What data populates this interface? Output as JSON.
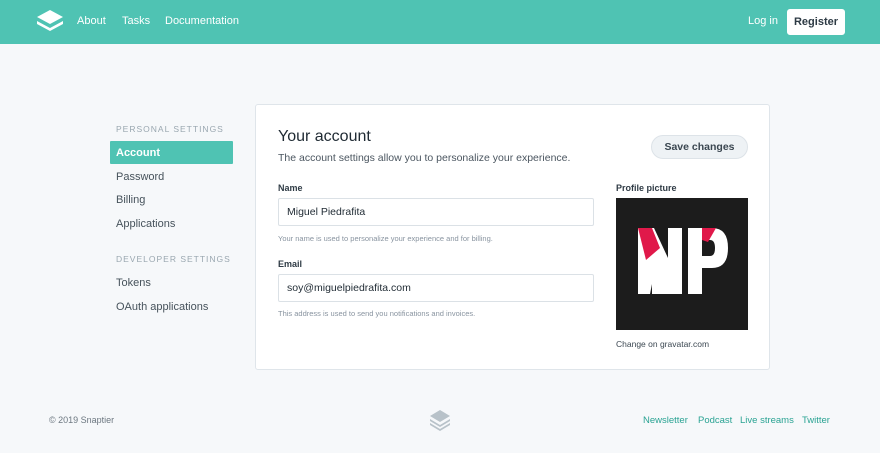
{
  "header": {
    "nav": [
      "About",
      "Tasks",
      "Documentation"
    ],
    "login": "Log in",
    "register": "Register"
  },
  "sidebar": {
    "personal_heading": "PERSONAL SETTINGS",
    "personal_items": [
      "Account",
      "Password",
      "Billing",
      "Applications"
    ],
    "developer_heading": "DEVELOPER SETTINGS",
    "developer_items": [
      "Tokens",
      "OAuth applications"
    ],
    "active_item": "Account"
  },
  "account": {
    "title": "Your account",
    "description": "The account settings allow you to personalize your experience.",
    "save_label": "Save changes",
    "name_label": "Name",
    "name_value": "Miguel Piedrafita",
    "name_help": "Your name is used to personalize your experience and for billing.",
    "email_label": "Email",
    "email_value": "soy@miguelpiedrafita.com",
    "email_help": "This address is used to send you notifications and invoices.",
    "profile_label": "Profile picture",
    "avatar_initials": "MP",
    "gravatar_link": "Change on gravatar.com"
  },
  "footer": {
    "copyright": "© 2019 Snaptier",
    "links": [
      "Newsletter",
      "Podcast",
      "Live streams",
      "Twitter"
    ]
  },
  "colors": {
    "accent": "#4fc3b3",
    "link": "#2aa393",
    "avatar_red": "#e0194a"
  }
}
